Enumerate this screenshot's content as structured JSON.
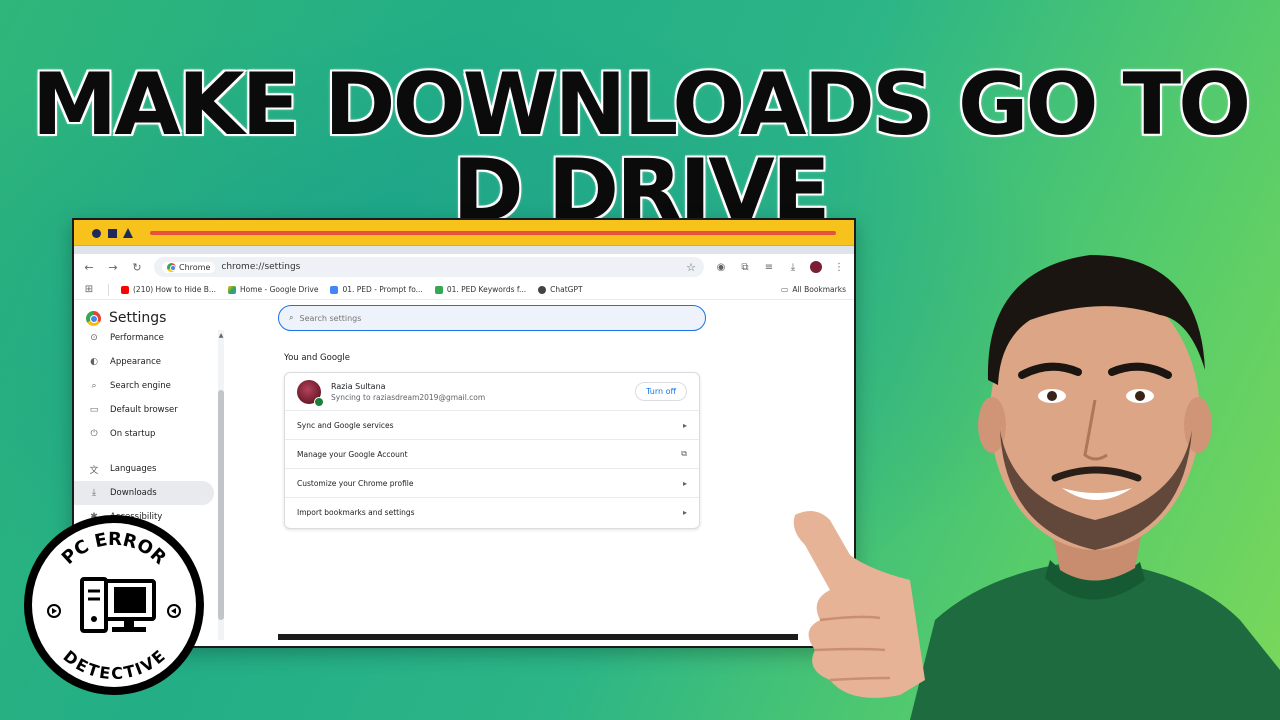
{
  "headline": "MAKE DOWNLOADS GO TO D DRIVE",
  "browser": {
    "omnibox": {
      "chip_label": "Chrome",
      "url": "chrome://settings"
    },
    "bookmarks": [
      {
        "label": "(210) How to Hide B...",
        "color": "#ff0000"
      },
      {
        "label": "Home - Google Drive",
        "color": "#fbbc05"
      },
      {
        "label": "01. PED - Prompt fo...",
        "color": "#4285f4"
      },
      {
        "label": "01. PED Keywords f...",
        "color": "#34a853"
      },
      {
        "label": "ChatGPT",
        "color": "#444444"
      }
    ],
    "all_bookmarks": "All Bookmarks",
    "settings_title": "Settings",
    "sidebar": [
      {
        "label": "Performance",
        "icon": "performance-icon",
        "glyph": "⊙"
      },
      {
        "label": "Appearance",
        "icon": "palette-icon",
        "glyph": "◐"
      },
      {
        "label": "Search engine",
        "icon": "search-icon",
        "glyph": "⌕"
      },
      {
        "label": "Default browser",
        "icon": "browser-icon",
        "glyph": "▭"
      },
      {
        "label": "On startup",
        "icon": "power-icon",
        "glyph": "⏻"
      },
      {
        "label": "Languages",
        "icon": "translate-icon",
        "glyph": "文"
      },
      {
        "label": "Downloads",
        "icon": "download-icon",
        "glyph": "⤓"
      },
      {
        "label": "Accessibility",
        "icon": "accessibility-icon",
        "glyph": "✱"
      }
    ],
    "search_placeholder": "Search settings",
    "section_title": "You and Google",
    "profile": {
      "name": "Razia Sultana",
      "sync_text": "Syncing to raziasdream2019@gmail.com",
      "turn_off": "Turn off"
    },
    "rows": [
      {
        "label": "Sync and Google services",
        "icon": "chevron-right-icon",
        "glyph": "▸"
      },
      {
        "label": "Manage your Google Account",
        "icon": "external-link-icon",
        "glyph": "⧉"
      },
      {
        "label": "Customize your Chrome profile",
        "icon": "chevron-right-icon",
        "glyph": "▸"
      },
      {
        "label": "Import bookmarks and settings",
        "icon": "chevron-right-icon",
        "glyph": "▸"
      }
    ]
  },
  "badge": {
    "top_text": "PC ERROR",
    "bottom_text": "DETECTIVE"
  }
}
